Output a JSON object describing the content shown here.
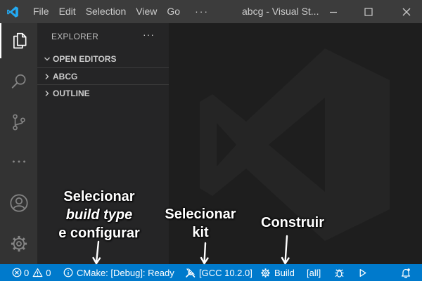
{
  "titlebar": {
    "menu": [
      "File",
      "Edit",
      "Selection",
      "View",
      "Go"
    ],
    "more": "···",
    "window_title": "abcg - Visual St..."
  },
  "sidebar": {
    "title": "EXPLORER",
    "more": "···",
    "sections": [
      "OPEN EDITORS",
      "ABCG",
      "OUTLINE"
    ]
  },
  "statusbar": {
    "errors": "0",
    "warnings": "0",
    "cmake": "CMake: [Debug]: Ready",
    "kit": "[GCC 10.2.0]",
    "build": "Build",
    "target": "[all]"
  },
  "annotations": {
    "build_type_line1": "Selecionar",
    "build_type_line2": "build type",
    "build_type_line3": "e configurar",
    "kit_line1": "Selecionar",
    "kit_line2": "kit",
    "build_label": "Construir"
  },
  "colors": {
    "statusbar": "#007acc",
    "titlebar": "#3c3c3c",
    "activitybar": "#333333",
    "sidebar": "#252526",
    "editor": "#1e1e1e",
    "vscode_blue": "#23a9f2"
  }
}
